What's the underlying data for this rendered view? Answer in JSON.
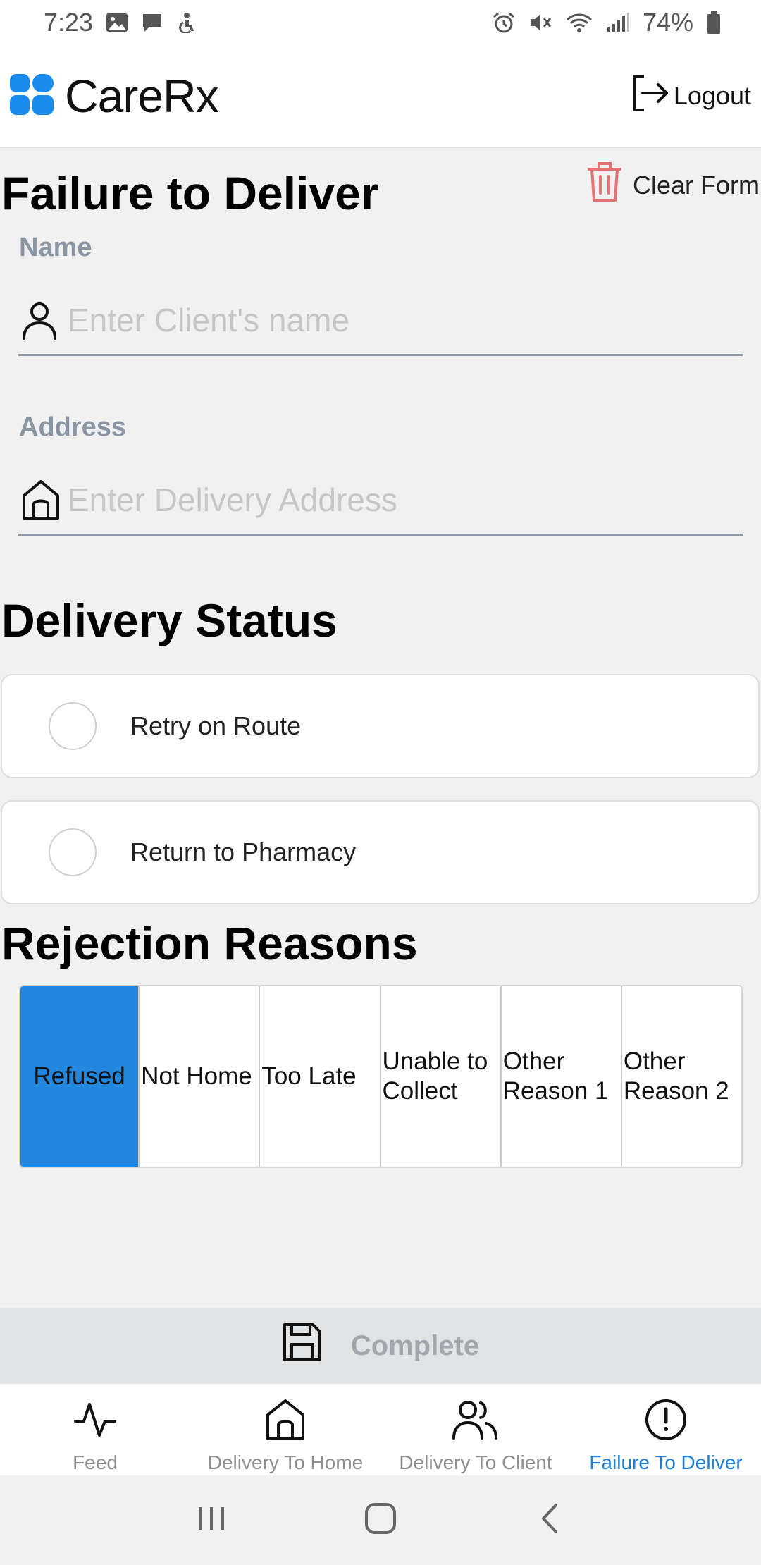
{
  "status_bar": {
    "time": "7:23",
    "battery": "74%",
    "left_icons": [
      "gallery-icon",
      "message-icon",
      "accessibility-icon"
    ],
    "right_icons": [
      "alarm-icon",
      "mute-icon",
      "wifi-icon",
      "signal-icon",
      "battery-icon"
    ]
  },
  "header": {
    "brand": "CareRx",
    "logout_label": "Logout"
  },
  "form": {
    "title": "Failure to Deliver",
    "clear_label": "Clear Form",
    "name_label": "Name",
    "name_placeholder": "Enter Client's name",
    "name_value": "",
    "address_label": "Address",
    "address_placeholder": "Enter Delivery Address",
    "address_value": ""
  },
  "delivery_status": {
    "title": "Delivery Status",
    "options": [
      {
        "label": "Retry on Route",
        "selected": false
      },
      {
        "label": "Return to Pharmacy",
        "selected": false
      }
    ]
  },
  "rejection": {
    "title": "Rejection Reasons",
    "reasons": [
      {
        "label": "Refused",
        "selected": true
      },
      {
        "label": "Not Home",
        "selected": false
      },
      {
        "label": "Too Late",
        "selected": false
      },
      {
        "label": "Unable to Collect",
        "selected": false
      },
      {
        "label": "Other Reason 1",
        "selected": false
      },
      {
        "label": "Other Reason 2",
        "selected": false
      }
    ]
  },
  "complete_label": "Complete",
  "bottom_nav": {
    "items": [
      {
        "label": "Feed",
        "icon": "activity-icon",
        "active": false
      },
      {
        "label": "Delivery To Home",
        "icon": "home-icon",
        "active": false
      },
      {
        "label": "Delivery To Client",
        "icon": "users-icon",
        "active": false
      },
      {
        "label": "Failure To Deliver",
        "icon": "alert-circle-icon",
        "active": true
      }
    ]
  },
  "colors": {
    "accent": "#2288df",
    "active_nav": "#1f7fd6",
    "trash": "#e57373",
    "logo_blue": "#1a8cf0"
  }
}
